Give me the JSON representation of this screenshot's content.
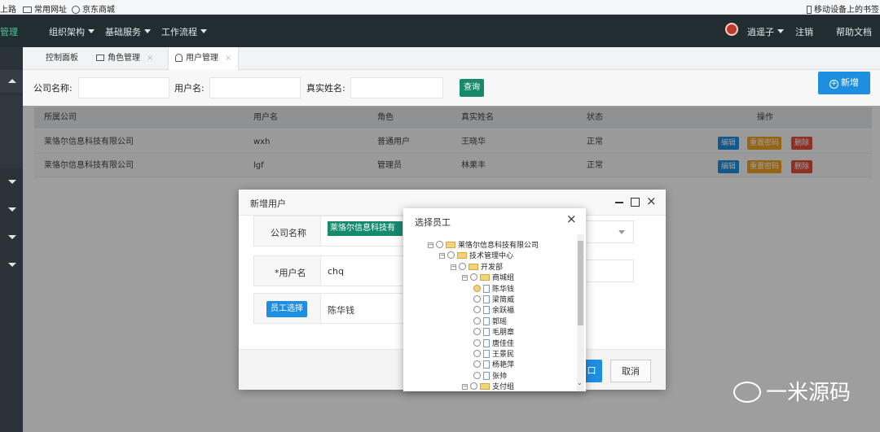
{
  "bookmarks": {
    "left_partial": "上路",
    "frequent": "常用网址",
    "jd": "京东商城",
    "mobile": "移动设备上的书签"
  },
  "navbar": {
    "brand_partial": "管理",
    "menus": [
      "组织架构",
      "基础服务",
      "工作流程"
    ],
    "user": "逍遥子",
    "logout": "注销",
    "help": "帮助文档"
  },
  "tabs": [
    {
      "label": "控制面板"
    },
    {
      "label": "角色管理"
    },
    {
      "label": "用户管理"
    }
  ],
  "search": {
    "company_label": "公司名称:",
    "username_label": "用户名:",
    "realname_label": "真实姓名:",
    "query_button": "查询",
    "add_button": "新增"
  },
  "table": {
    "headers": [
      "所属公司",
      "用户名",
      "角色",
      "真实姓名",
      "状态",
      "操作"
    ],
    "rows": [
      {
        "company": "莱恪尔信息科技有限公司",
        "username": "wxh",
        "role": "普通用户",
        "realname": "王晓华",
        "status": "正常"
      },
      {
        "company": "莱恪尔信息科技有限公司",
        "username": "lgf",
        "role": "管理员",
        "realname": "林果丰",
        "status": "正常"
      }
    ],
    "actions": {
      "edit": "编辑",
      "reset": "重置密码",
      "delete": "删除"
    }
  },
  "dialog": {
    "title": "新增用户",
    "company_label": "公司名称",
    "company_value": "莱恪尔信息科技有",
    "username_label": "*用户名",
    "username_value": "chq",
    "employee_button": "员工选择",
    "employee_value": "陈华钱",
    "confirm_partial": "口",
    "cancel_button": "取消"
  },
  "picker": {
    "title": "选择员工",
    "tree": [
      {
        "label": "莱恪尔信息科技有限公司",
        "level": 0,
        "kind": "folder"
      },
      {
        "label": "技术管理中心",
        "level": 1,
        "kind": "folder"
      },
      {
        "label": "开发部",
        "level": 2,
        "kind": "folder"
      },
      {
        "label": "商城组",
        "level": 3,
        "kind": "folder"
      },
      {
        "label": "陈华钱",
        "level": 4,
        "kind": "file",
        "selected": true
      },
      {
        "label": "梁简威",
        "level": 4,
        "kind": "file"
      },
      {
        "label": "余跃福",
        "level": 4,
        "kind": "file"
      },
      {
        "label": "郭瑶",
        "level": 4,
        "kind": "file"
      },
      {
        "label": "毛朋章",
        "level": 4,
        "kind": "file"
      },
      {
        "label": "唐佳佳",
        "level": 4,
        "kind": "file"
      },
      {
        "label": "王景民",
        "level": 4,
        "kind": "file"
      },
      {
        "label": "杨艳萍",
        "level": 4,
        "kind": "file"
      },
      {
        "label": "张帅",
        "level": 4,
        "kind": "file"
      },
      {
        "label": "支付组",
        "level": 3,
        "kind": "folder"
      }
    ]
  },
  "watermark": {
    "text": "一米源码"
  },
  "colors": {
    "nav": "#222d32",
    "teal": "#17896c",
    "blue": "#1e8ee0",
    "reset": "#f0a31f",
    "delete": "#e74c3c"
  }
}
